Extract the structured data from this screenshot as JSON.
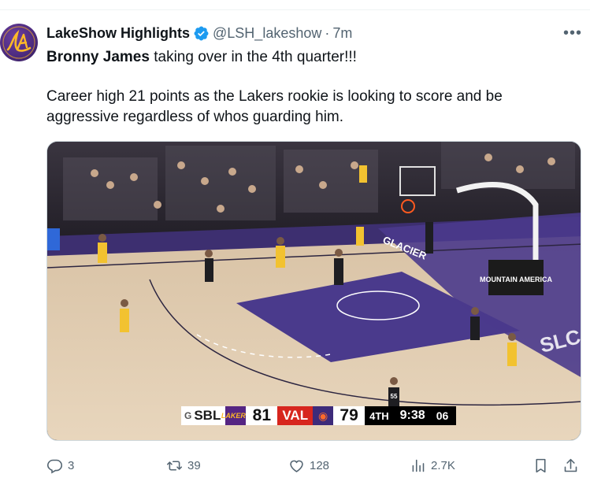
{
  "tweet": {
    "display_name": "LakeShow Highlights",
    "avatar_glyph": "LA",
    "handle": "@LSH_lakeshow",
    "separator": "·",
    "time": "7m",
    "more_label": "•••",
    "text_line1_bold": "Bronny James",
    "text_line1_rest": " taking over in the 4th quarter!!!",
    "text_line2": "Career high 21 points as the Lakers rookie is looking to score and be aggressive regardless of whos guarding him.",
    "verified_icon": "verified-badge-icon",
    "colors": {
      "verified": "#1d9bf0",
      "muted": "#536471",
      "text": "#0f1419"
    }
  },
  "video": {
    "court_text_left": "GLACIER",
    "court_text_right": "SLC",
    "baseline_sign": "MOUNTAIN AMERICA",
    "jersey_front": "55",
    "scorebug": {
      "league": "SBL",
      "league_prefix": "G",
      "home_logo": "LAKERS",
      "home_score": "81",
      "away_abbr": "VAL",
      "away_logo": "◉",
      "away_score": "79",
      "period": "4TH",
      "clock": "9:38",
      "shot_clock": "06"
    }
  },
  "actions": {
    "replies": "3",
    "reposts": "39",
    "likes": "128",
    "views": "2.7K",
    "icons": [
      "reply-icon",
      "repost-icon",
      "like-icon",
      "views-icon",
      "bookmark-icon",
      "share-icon"
    ]
  }
}
